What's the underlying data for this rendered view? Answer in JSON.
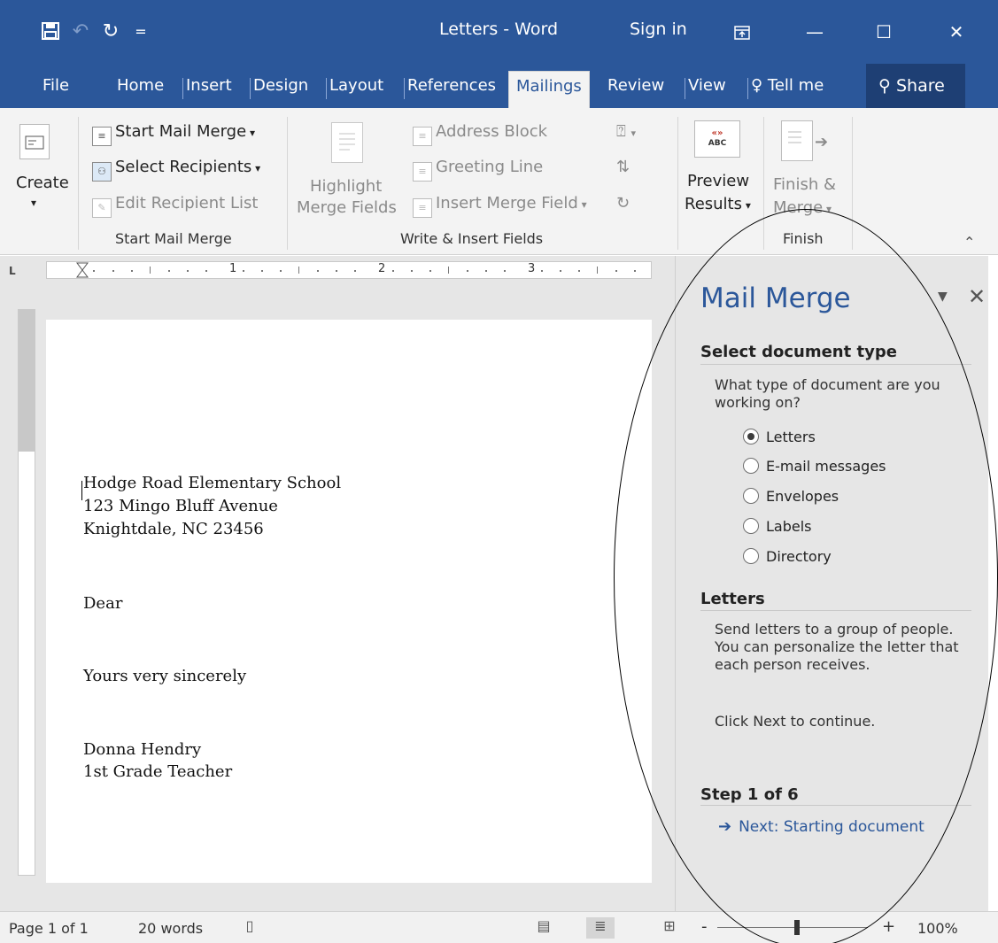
{
  "window": {
    "title": "Letters - Word",
    "sign_in": "Sign in"
  },
  "quick_access": {
    "icons": [
      "save-icon",
      "undo-icon",
      "redo-icon",
      "customize-icon"
    ]
  },
  "tabs": {
    "file": "File",
    "home": "Home",
    "insert": "Insert",
    "design": "Design",
    "layout": "Layout",
    "references": "References",
    "mailings": "Mailings",
    "review": "Review",
    "view": "View",
    "tell_me": "Tell me",
    "share": "Share",
    "active": "Mailings"
  },
  "ribbon": {
    "create": "Create",
    "start_mail_merge": "Start Mail Merge",
    "select_recipients": "Select Recipients",
    "edit_recipient_list": "Edit Recipient List",
    "group_start": "Start Mail Merge",
    "highlight_1": "Highlight",
    "highlight_2": "Merge Fields",
    "address_block": "Address Block",
    "greeting_line": "Greeting Line",
    "insert_merge_field": "Insert Merge Field",
    "group_write": "Write & Insert Fields",
    "preview_1": "Preview",
    "preview_2": "Results",
    "preview_icon_text": "«»\nABC",
    "finish_1": "Finish &",
    "finish_2": "Merge",
    "group_finish": "Finish"
  },
  "ruler": {
    "marks": [
      "1",
      "2",
      "3"
    ]
  },
  "document": {
    "address_1": "Hodge Road Elementary School",
    "address_2": "123 Mingo Bluff Avenue",
    "address_3": "Knightdale, NC 23456",
    "salutation": "Dear",
    "closing": "Yours very sincerely",
    "signer_name": "Donna Hendry",
    "signer_title": "1st Grade Teacher"
  },
  "pane": {
    "title": "Mail Merge",
    "section1_heading": "Select document type",
    "section1_question": "What type of document are you working on?",
    "options": [
      {
        "label": "Letters",
        "selected": true
      },
      {
        "label": "E-mail messages",
        "selected": false
      },
      {
        "label": "Envelopes",
        "selected": false
      },
      {
        "label": "Labels",
        "selected": false
      },
      {
        "label": "Directory",
        "selected": false
      }
    ],
    "section2_heading": "Letters",
    "section2_text": "Send letters to a group of people. You can personalize the letter that each person receives.",
    "section2_hint": "Click Next to continue.",
    "step_heading": "Step 1 of 6",
    "next_link": "Next: Starting document"
  },
  "status": {
    "page": "Page 1 of 1",
    "words": "20 words",
    "zoom": "100%",
    "zoom_minus": "-",
    "zoom_plus": "+"
  },
  "colors": {
    "brand": "#2b579a",
    "ribbon_bg": "#f3f3f3",
    "pane_bg": "#e6e6e6"
  }
}
